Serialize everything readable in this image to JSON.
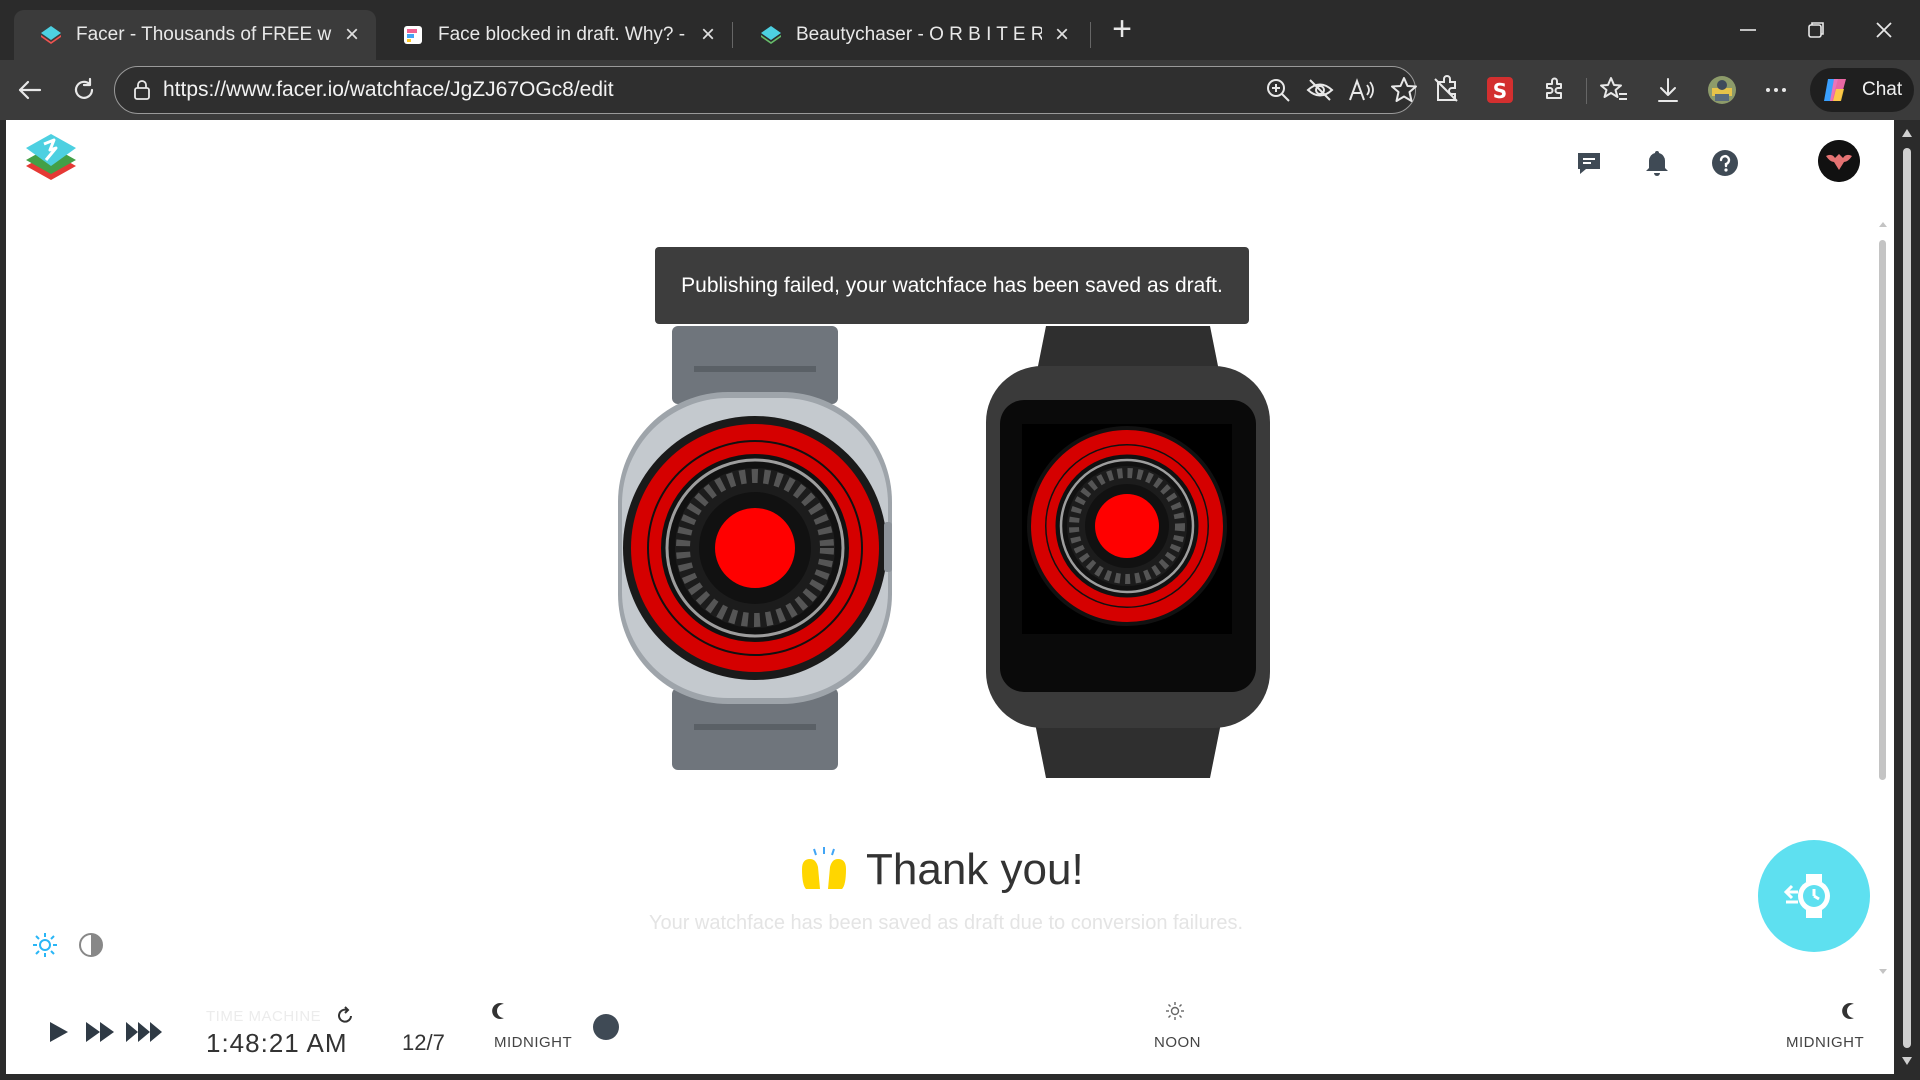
{
  "browser": {
    "tabs": [
      {
        "title": "Facer - Thousands of FREE watch faces",
        "active": true
      },
      {
        "title": "Face blocked in draft. Why? - Support",
        "active": false
      },
      {
        "title": "Beautychaser - O R B I T E R - watch face",
        "active": false
      }
    ],
    "url": "https://www.facer.io/watchface/JgZJ67OGc8/edit",
    "chat_label": "Chat"
  },
  "page": {
    "toast": "Publishing failed, your watchface has been saved as draft.",
    "thanks_title": "Thank you!",
    "thanks_subtitle": "Your watchface has been saved as draft due to conversion failures.",
    "accent_color": "#5ee0f0",
    "watch_face_color": "#ff0000"
  },
  "time_machine": {
    "label": "TIME MACHINE",
    "time": "1:48:21 AM",
    "date": "12/7",
    "timeline": {
      "start_label": "MIDNIGHT",
      "mid_label": "NOON",
      "end_label": "MIDNIGHT"
    }
  }
}
